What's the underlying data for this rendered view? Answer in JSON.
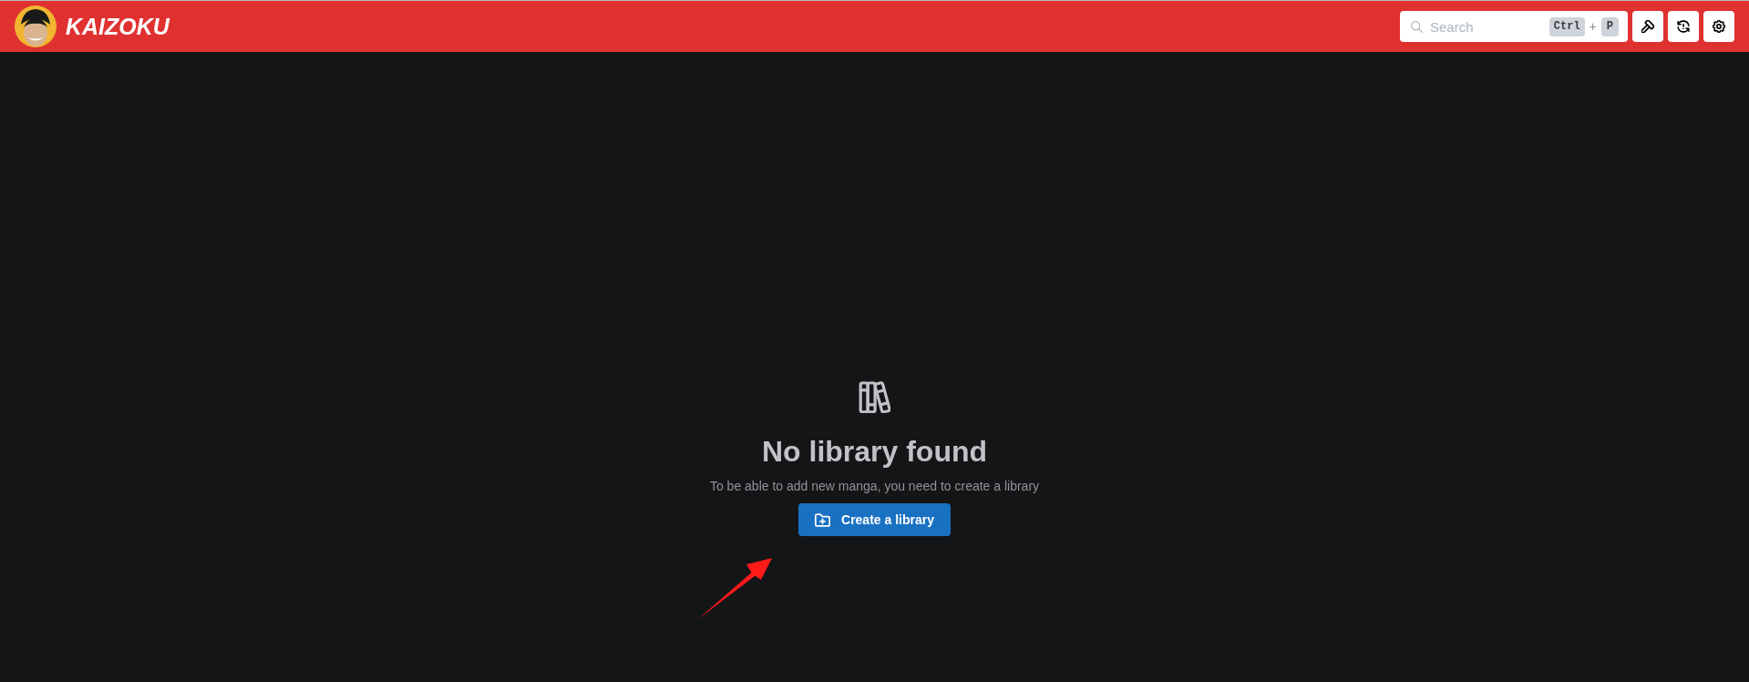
{
  "header": {
    "logo_text": "KAIZOKU",
    "search": {
      "placeholder": "Search",
      "shortcut": [
        "Ctrl",
        "P"
      ],
      "shortcut_separator": "+"
    },
    "actions": [
      {
        "kind": "hammer"
      },
      {
        "kind": "refresh-alert"
      },
      {
        "kind": "settings"
      }
    ]
  },
  "empty_state": {
    "title": "No library found",
    "message": "To be able to add new manga, you need to create a library",
    "button": "Create a library"
  }
}
